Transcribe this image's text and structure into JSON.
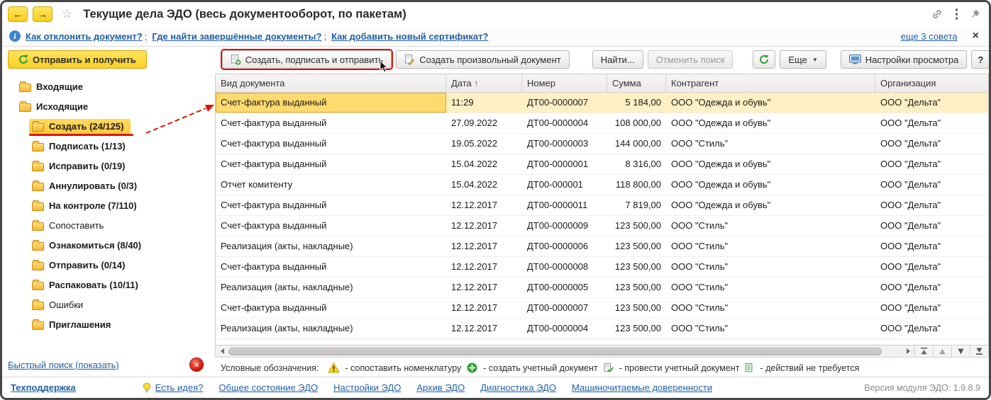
{
  "titlebar": {
    "title": "Текущие дела ЭДО (весь документооборот, по пакетам)"
  },
  "icons": {
    "back": "←",
    "forward": "→",
    "star": "☆",
    "close": "×",
    "dropdown": "▼",
    "info": "i"
  },
  "info_bar": {
    "separator": ";",
    "links": [
      "Как отклонить документ?",
      "Где найти завершённые документы?",
      "Как добавить новый сертификат?"
    ],
    "more_link": "еще 3 совета"
  },
  "toolbar": {
    "send_receive": "Отправить и получить",
    "create_sign_send": "Создать, подписать и отправить",
    "create_arbitrary": "Создать произвольный документ",
    "find": "Найти...",
    "cancel_search": "Отменить поиск",
    "more": "Еще",
    "view_settings": "Настройки просмотра",
    "help": "?"
  },
  "sidebar": {
    "items": [
      {
        "id": "incoming",
        "label": "Входящие",
        "level": 0,
        "bold": true
      },
      {
        "id": "outgoing",
        "label": "Исходящие",
        "level": 0,
        "bold": true
      },
      {
        "id": "create",
        "label": "Создать (24/125)",
        "level": 1,
        "bold": true,
        "selected": true
      },
      {
        "id": "sign",
        "label": "Подписать (1/13)",
        "level": 1,
        "bold": true
      },
      {
        "id": "fix",
        "label": "Исправить (0/19)",
        "level": 1,
        "bold": true
      },
      {
        "id": "annul",
        "label": "Аннулировать (0/3)",
        "level": 1,
        "bold": true
      },
      {
        "id": "on-control",
        "label": "На контроле (7/110)",
        "level": 1,
        "bold": true
      },
      {
        "id": "match",
        "label": "Сопоставить",
        "level": 1,
        "bold": false
      },
      {
        "id": "review",
        "label": "Ознакомиться (8/40)",
        "level": 1,
        "bold": true
      },
      {
        "id": "send",
        "label": "Отправить (0/14)",
        "level": 1,
        "bold": true
      },
      {
        "id": "unpack",
        "label": "Распаковать (10/11)",
        "level": 1,
        "bold": true
      },
      {
        "id": "errors",
        "label": "Ошибки",
        "level": 1,
        "bold": false
      },
      {
        "id": "invitations",
        "label": "Приглашения",
        "level": 1,
        "bold": true
      }
    ],
    "quick_search": "Быстрый поиск (показать)"
  },
  "table": {
    "columns": [
      {
        "id": "doc-type",
        "label": "Вид документа"
      },
      {
        "id": "date",
        "label": "Дата",
        "sorted": true
      },
      {
        "id": "number",
        "label": "Номер"
      },
      {
        "id": "sum",
        "label": "Сумма"
      },
      {
        "id": "counterparty",
        "label": "Контрагент"
      },
      {
        "id": "organization",
        "label": "Организация"
      }
    ],
    "sort_indicator": "↑",
    "rows": [
      {
        "selected": true,
        "cells": [
          "Счет-фактура выданный",
          "11:29",
          "ДТ00-0000007",
          "5 184,00",
          "ООО \"Одежда и обувь\"",
          "ООО \"Дельта\""
        ]
      },
      {
        "cells": [
          "Счет-фактура выданный",
          "27.09.2022",
          "ДТ00-0000004",
          "108 000,00",
          "ООО \"Одежда и обувь\"",
          "ООО \"Дельта\""
        ]
      },
      {
        "cells": [
          "Счет-фактура выданный",
          "19.05.2022",
          "ДТ00-0000003",
          "144 000,00",
          "ООО \"Стиль\"",
          "ООО \"Дельта\""
        ]
      },
      {
        "cells": [
          "Счет-фактура выданный",
          "15.04.2022",
          "ДТ00-0000001",
          "8 316,00",
          "ООО \"Одежда и обувь\"",
          "ООО \"Дельта\""
        ]
      },
      {
        "cells": [
          "Отчет комитенту",
          "15.04.2022",
          "ДТ00-000001",
          "118 800,00",
          "ООО \"Одежда и обувь\"",
          "ООО \"Дельта\""
        ]
      },
      {
        "cells": [
          "Счет-фактура выданный",
          "12.12.2017",
          "ДТ00-0000011",
          "7 819,00",
          "ООО \"Одежда и обувь\"",
          "ООО \"Дельта\""
        ]
      },
      {
        "cells": [
          "Счет-фактура выданный",
          "12.12.2017",
          "ДТ00-0000009",
          "123 500,00",
          "ООО \"Стиль\"",
          "ООО \"Дельта\""
        ]
      },
      {
        "cells": [
          "Реализация (акты, накладные)",
          "12.12.2017",
          "ДТ00-0000006",
          "123 500,00",
          "ООО \"Стиль\"",
          "ООО \"Дельта\""
        ]
      },
      {
        "cells": [
          "Счет-фактура выданный",
          "12.12.2017",
          "ДТ00-0000008",
          "123 500,00",
          "ООО \"Стиль\"",
          "ООО \"Дельта\""
        ]
      },
      {
        "cells": [
          "Реализация (акты, накладные)",
          "12.12.2017",
          "ДТ00-0000005",
          "123 500,00",
          "ООО \"Стиль\"",
          "ООО \"Дельта\""
        ]
      },
      {
        "cells": [
          "Счет-фактура выданный",
          "12.12.2017",
          "ДТ00-0000007",
          "123 500,00",
          "ООО \"Стиль\"",
          "ООО \"Дельта\""
        ]
      },
      {
        "cells": [
          "Реализация (акты, накладные)",
          "12.12.2017",
          "ДТ00-0000004",
          "123 500,00",
          "ООО \"Стиль\"",
          "ООО \"Дельта\""
        ]
      }
    ]
  },
  "legend": {
    "label": "Условные обозначения:",
    "items": [
      {
        "icon": "warning-icon",
        "text": "- сопоставить номенклатуру"
      },
      {
        "icon": "plus-circle-icon",
        "text": "- создать учетный документ"
      },
      {
        "icon": "post-document-icon",
        "text": "- провести учетный документ"
      },
      {
        "icon": "no-action-icon",
        "text": "- действий не требуется"
      }
    ]
  },
  "footer": {
    "support": "Техподдержка",
    "idea": "Есть идея?",
    "links": [
      "Общее состояние ЭДО",
      "Настройки ЭДО",
      "Архив ЭДО",
      "Диагностика ЭДО",
      "Машиночитаемые доверенности"
    ],
    "version": "Версия модуля ЭДО: 1.9.8.9"
  },
  "colors": {
    "accent_yellow": "#fbce25",
    "selection": "#ffefc4",
    "annotation_red": "#de1505",
    "link_blue": "#1f5fa9"
  }
}
